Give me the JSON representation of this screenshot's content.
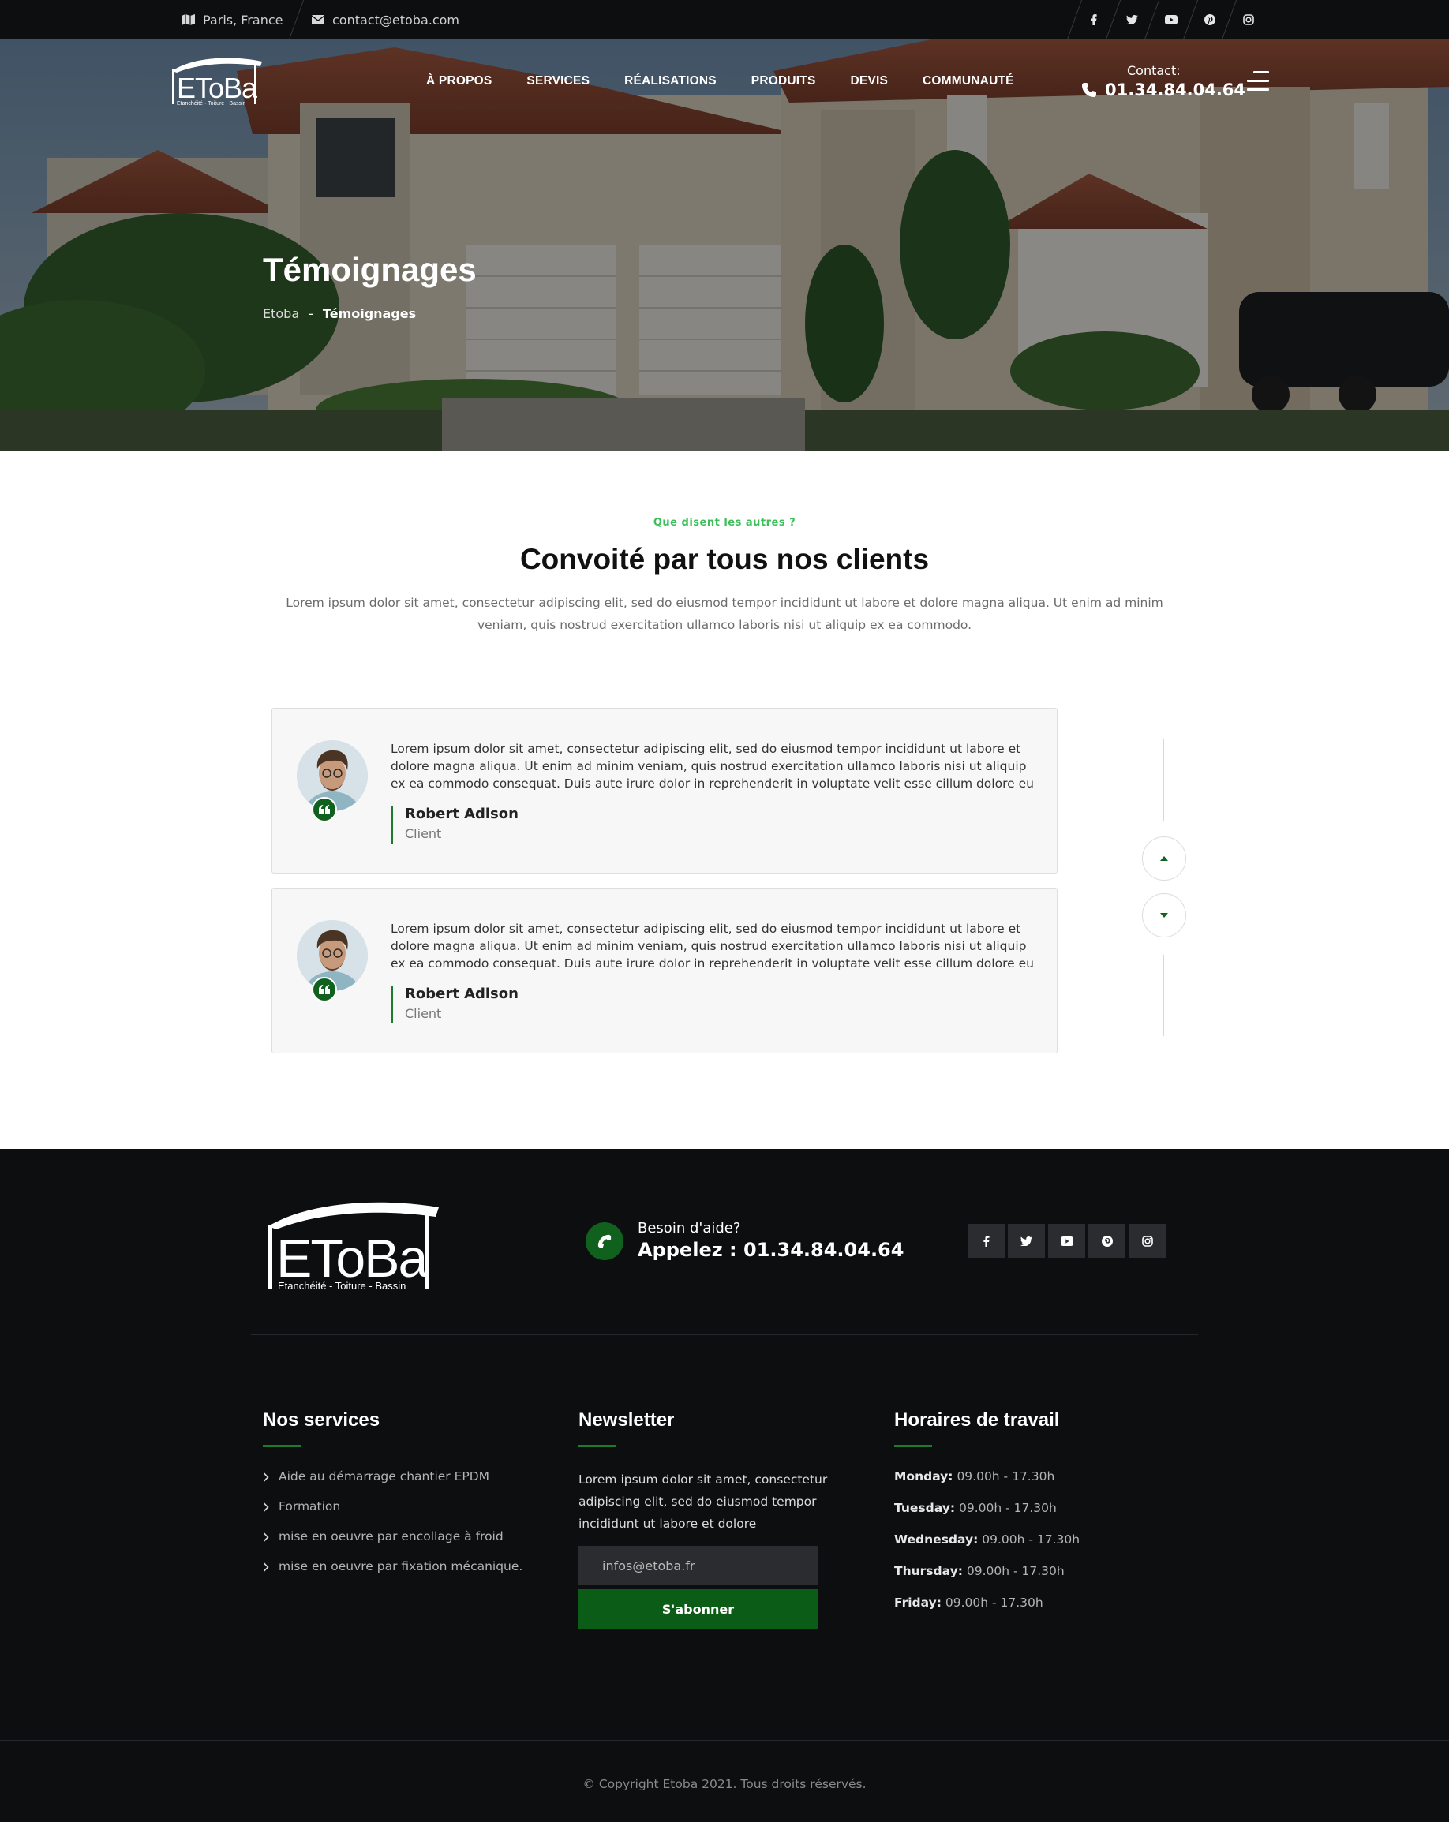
{
  "topbar": {
    "location": "Paris, France",
    "email": "contact@etoba.com",
    "social": [
      "facebook-icon",
      "twitter-icon",
      "youtube-icon",
      "pinterest-icon",
      "instagram-icon"
    ]
  },
  "brand": {
    "logo_text": "EToBa",
    "tagline": "Etanchéité - Toiture - Bassin"
  },
  "nav": {
    "items": [
      "À PROPOS",
      "SERVICES",
      "RÉALISATIONS",
      "PRODUITS",
      "DEVIS",
      "COMMUNAUTÉ"
    ],
    "contact_label": "Contact:",
    "contact_phone": "01.34.84.04.64"
  },
  "hero": {
    "title": "Témoignages",
    "breadcrumb": [
      "Etoba",
      "-",
      "Témoignages"
    ]
  },
  "testimonials": {
    "eyebrow": "Que disent les autres ?",
    "title": "Convoité par tous nos clients",
    "description": "Lorem ipsum dolor sit amet, consectetur adipiscing elit, sed do eiusmod tempor incididunt ut labore et dolore magna aliqua. Ut enim ad minim veniam, quis nostrud exercitation ullamco laboris nisi ut aliquip ex ea commodo.",
    "items": [
      {
        "text": "Lorem ipsum dolor sit amet, consectetur adipiscing elit, sed do eiusmod tempor incididunt ut labore et dolore magna aliqua. Ut enim ad minim veniam, quis nostrud exercitation ullamco laboris nisi ut aliquip ex ea commodo consequat. Duis aute irure dolor in reprehenderit in voluptate velit esse cillum dolore eu",
        "name": "Robert Adison",
        "role": "Client"
      },
      {
        "text": "Lorem ipsum dolor sit amet, consectetur adipiscing elit, sed do eiusmod tempor incididunt ut labore et dolore magna aliqua. Ut enim ad minim veniam, quis nostrud exercitation ullamco laboris nisi ut aliquip ex ea commodo consequat. Duis aute irure dolor in reprehenderit in voluptate velit esse cillum dolore eu",
        "name": "Robert Adison",
        "role": "Client"
      }
    ]
  },
  "footer": {
    "help_label": "Besoin d'aide?",
    "help_call": "Appelez : 01.34.84.04.64",
    "services_title": "Nos services",
    "services": [
      "Aide au démarrage chantier EPDM",
      "Formation",
      "mise en oeuvre par encollage à froid",
      "mise en oeuvre par fixation mécanique."
    ],
    "newsletter_title": "Newsletter",
    "newsletter_text": "Lorem ipsum dolor sit amet, consectetur adipiscing elit, sed do eiusmod tempor incididunt ut labore et dolore",
    "newsletter_placeholder": "infos@etoba.fr",
    "newsletter_button": "S'abonner",
    "hours_title": "Horaires de travail",
    "hours": [
      {
        "day": "Monday:",
        "time": "09.00h - 17.30h"
      },
      {
        "day": "Tuesday:",
        "time": "09.00h - 17.30h"
      },
      {
        "day": "Wednesday:",
        "time": "09.00h - 17.30h"
      },
      {
        "day": "Thursday:",
        "time": "09.00h - 17.30h"
      },
      {
        "day": "Friday:",
        "time": "09.00h - 17.30h"
      }
    ],
    "copyright": "© Copyright Etoba 2021. Tous droits réservés."
  },
  "colors": {
    "accent_green": "#10611e",
    "eyebrow_green": "#3dbf5a",
    "dark_bg": "#0d0e10"
  }
}
